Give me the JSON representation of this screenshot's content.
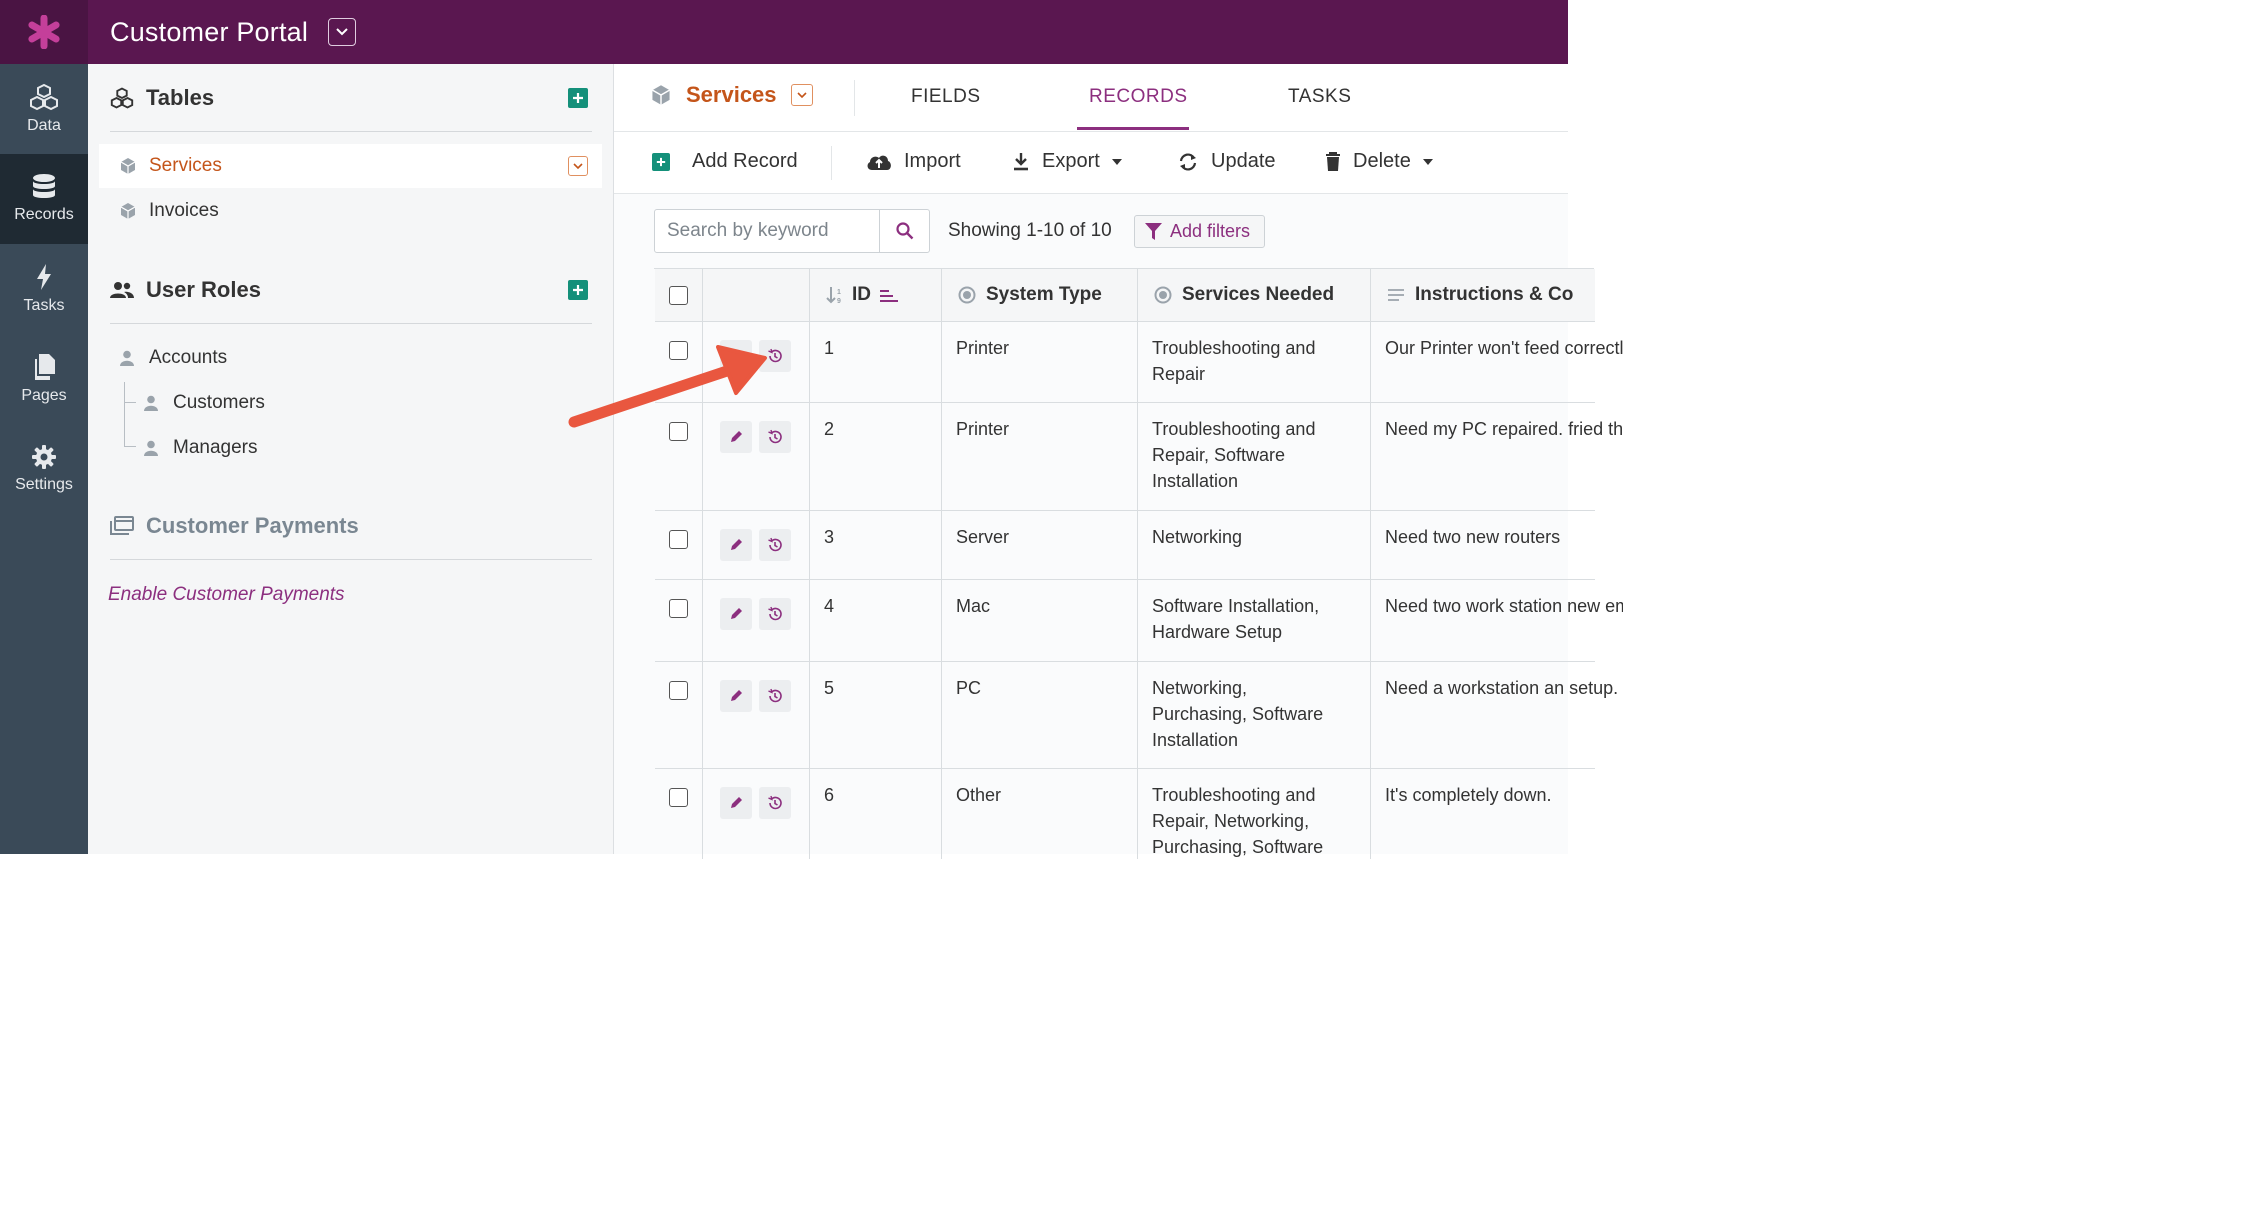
{
  "app": {
    "title": "Customer Portal",
    "brand_color": "#5a1750",
    "accent": "#8c2f7f",
    "object_color": "#c4551a"
  },
  "nav": {
    "items": [
      {
        "label": "Data",
        "icon": "cubes-icon"
      },
      {
        "label": "Records",
        "icon": "database-icon",
        "active": true
      },
      {
        "label": "Tasks",
        "icon": "bolt-icon"
      },
      {
        "label": "Pages",
        "icon": "pages-icon"
      },
      {
        "label": "Settings",
        "icon": "gear-icon"
      }
    ]
  },
  "sidebar": {
    "tables_title": "Tables",
    "tables": [
      {
        "label": "Services",
        "selected": true
      },
      {
        "label": "Invoices"
      }
    ],
    "roles_title": "User Roles",
    "roles": [
      "Accounts",
      "Customers",
      "Managers"
    ],
    "payments_title": "Customer Payments",
    "payments_link": "Enable Customer Payments"
  },
  "main": {
    "object_name": "Services",
    "tabs": [
      "FIELDS",
      "RECORDS",
      "TASKS"
    ],
    "active_tab": "RECORDS",
    "toolbar": {
      "add": "Add Record",
      "import": "Import",
      "export": "Export",
      "update": "Update",
      "delete": "Delete"
    },
    "search_placeholder": "Search by keyword",
    "showing": "Showing 1-10 of 10",
    "filters": "Add filters"
  },
  "table": {
    "columns": [
      "ID",
      "System Type",
      "Services Needed",
      "Instructions & Co"
    ],
    "rows": [
      {
        "id": "1",
        "system": "Printer",
        "services": "Troubleshooting and\nRepair",
        "instructions": "Our Printer won't feed\ncorrectly."
      },
      {
        "id": "2",
        "system": "Printer",
        "services": "Troubleshooting and\nRepair, Software\nInstallation",
        "instructions": "Need my PC repaired.\nfried the hard drive."
      },
      {
        "id": "3",
        "system": "Server",
        "services": "Networking",
        "instructions": "Need two new routers"
      },
      {
        "id": "4",
        "system": "Mac",
        "services": "Software Installation,\nHardware Setup",
        "instructions": "Need two work station\nnew employees."
      },
      {
        "id": "5",
        "system": "PC",
        "services": "Networking,\nPurchasing, Software\nInstallation",
        "instructions": "Need a workstation an\nsetup."
      },
      {
        "id": "6",
        "system": "Other",
        "services": "Troubleshooting and\nRepair, Networking,\nPurchasing, Software",
        "instructions": "It's completely down."
      }
    ]
  }
}
